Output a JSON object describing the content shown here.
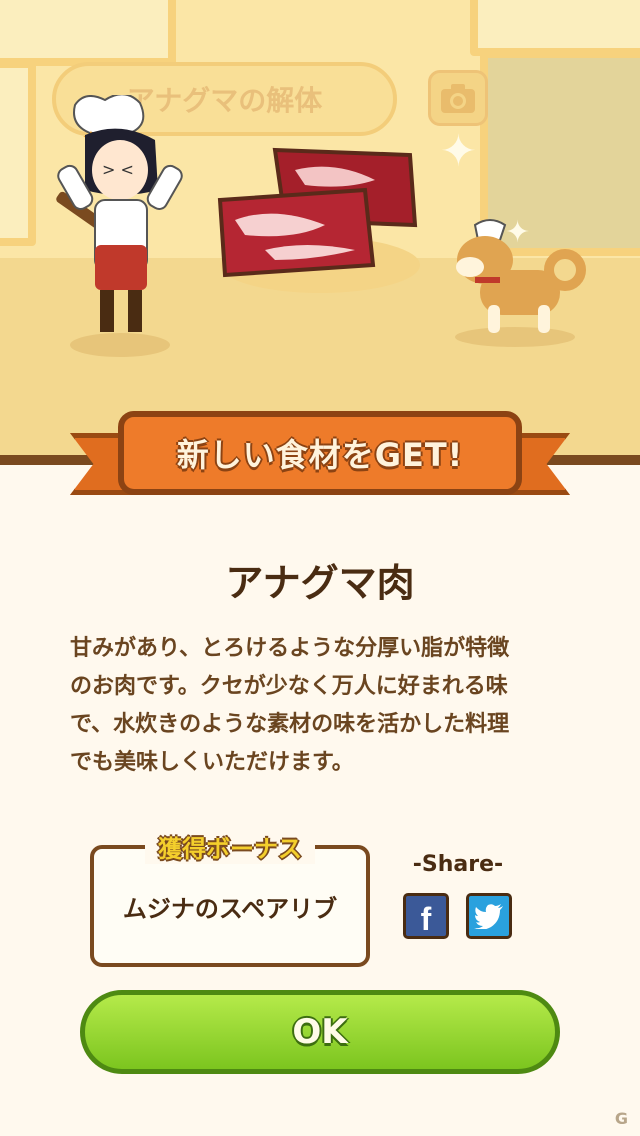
{
  "scene": {
    "title": "アナグマの解体",
    "camera_icon": "camera-icon",
    "sparkle_glyph": "✦"
  },
  "banner": {
    "text": "新しい食材をGET!"
  },
  "item": {
    "name": "アナグマ肉",
    "description": "甘みがあり、とろけるような分厚い脂が特徴\nのお肉です。クセが少なく万人に好まれる味\nで、水炊きのような素材の味を活かした料理\nでも美味しくいただけます。"
  },
  "bonus": {
    "title": "獲得ボーナス",
    "value": "ムジナのスペアリブ"
  },
  "share": {
    "label": "-Share-",
    "facebook_glyph": "f",
    "facebook_icon": "facebook-icon",
    "twitter_icon": "twitter-icon"
  },
  "ok_button": {
    "label": "OK"
  },
  "watermark": {
    "text": "G"
  },
  "colors": {
    "banner_orange": "#ee7b2a",
    "ok_green": "#7cc51f",
    "text_brown": "#4a2c12",
    "bonus_yellow": "#f4cf2c"
  }
}
